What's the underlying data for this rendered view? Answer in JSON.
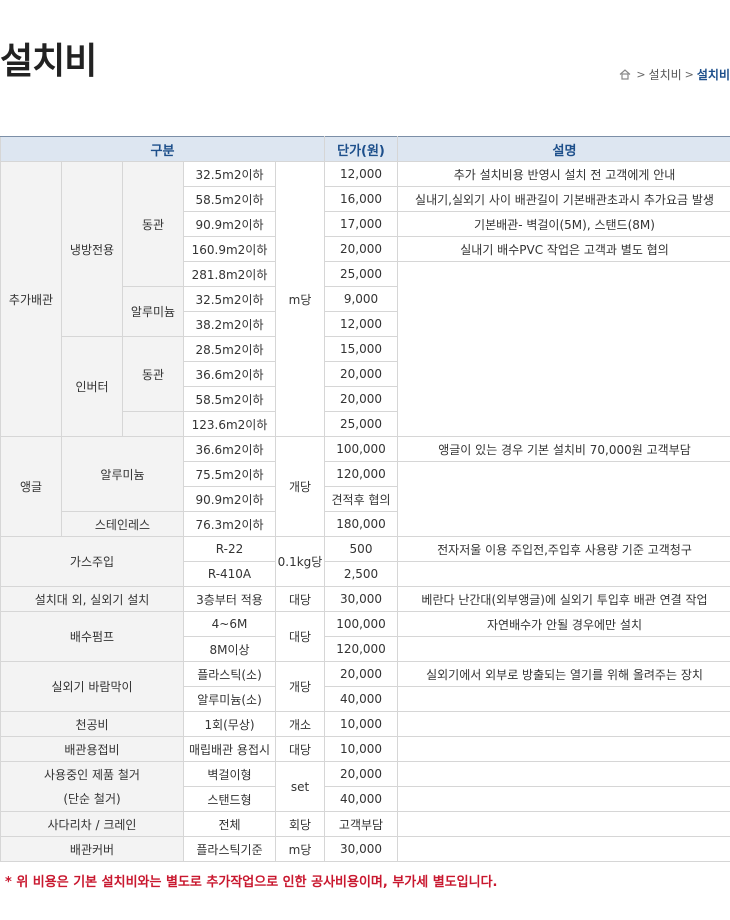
{
  "page": {
    "title": "설치비",
    "breadcrumb": [
      "설치비",
      "설치비"
    ],
    "footer_note": "* 위 비용은 기본 설치비와는 별도로 추가작업으로 인한 공사비용이며, 부가세 별도입니다."
  },
  "table": {
    "headers": {
      "category": "구분",
      "price": "단가(원)",
      "desc": "설명"
    },
    "colors": {
      "header_bg": "#dde6f1",
      "header_text": "#1d4f8b",
      "label_bg": "#f3f3f3",
      "note": "#c9182f"
    },
    "cells": {
      "c_extra": "추가배관",
      "c_cool": "냉방전용",
      "c_copper1": "동관",
      "c_alu1": "알루미늄",
      "c_inverter": "인버터",
      "c_copper2": "동관",
      "c_angle": "앵글",
      "c_alu2": "알루미늄",
      "c_stainless": "스테인레스",
      "u_m": "m당",
      "u_each": "개당",
      "c_gas": "가스주입",
      "u_kg": "0.1kg당",
      "c_stand": "설치대 외, 실외기 설치",
      "c_pump": "배수펌프",
      "u_each2": "대당",
      "c_wind": "실외기 바람막이",
      "u_each3": "개당",
      "c_ceiling": "천공비",
      "c_weld": "배관용접비",
      "c_remove1": "사용중인 제품 철거",
      "c_remove2": "(단순 철거)",
      "u_set": "set",
      "c_ladder": "사다리차 / 크레인",
      "c_cover": "배관커버"
    },
    "rows": [
      {
        "spec": "32.5m2이하",
        "price": "12,000",
        "desc": "추가 설치비용 반영시 설치 전 고객에게 안내"
      },
      {
        "spec": "58.5m2이하",
        "price": "16,000",
        "desc": "실내기,실외기 사이 배관길이  기본배관초과시 추가요금 발생"
      },
      {
        "spec": "90.9m2이하",
        "price": "17,000",
        "desc": "기본배관- 벽걸이(5M), 스탠드(8M)"
      },
      {
        "spec": "160.9m2이하",
        "price": "20,000",
        "desc": "실내기 배수PVC 작업은 고객과 별도 협의"
      },
      {
        "spec": "281.8m2이하",
        "price": "25,000",
        "desc": ""
      },
      {
        "spec": "32.5m2이하",
        "price": "9,000",
        "desc": ""
      },
      {
        "spec": "38.2m2이하",
        "price": "12,000",
        "desc": ""
      },
      {
        "spec": "28.5m2이하",
        "price": "15,000",
        "desc": ""
      },
      {
        "spec": "36.6m2이하",
        "price": "20,000",
        "desc": ""
      },
      {
        "spec": "58.5m2이하",
        "price": "20,000",
        "desc": ""
      },
      {
        "spec": "123.6m2이하",
        "price": "25,000",
        "desc": ""
      },
      {
        "spec": "36.6m2이하",
        "price": "100,000",
        "desc": "앵글이 있는 경우 기본 설치비 70,000원 고객부담"
      },
      {
        "spec": "75.5m2이하",
        "price": "120,000",
        "desc": ""
      },
      {
        "spec": "90.9m2이하",
        "price": "견적후 협의",
        "desc": ""
      },
      {
        "spec": "76.3m2이하",
        "price": "180,000",
        "desc": ""
      },
      {
        "spec": "R-22",
        "price": "500",
        "desc": "전자저울 이용 주입전,주입후 사용량 기준 고객청구"
      },
      {
        "spec": "R-410A",
        "price": "2,500",
        "desc": ""
      },
      {
        "spec": "3층부터 적용",
        "unit": "대당",
        "price": "30,000",
        "desc": "베란다 난간대(외부앵글)에 실외기 투입후 배관 연결 작업"
      },
      {
        "spec": "4~6M",
        "price": "100,000",
        "desc": "자연배수가 안될 경우에만 설치"
      },
      {
        "spec": "8M이상",
        "price": "120,000",
        "desc": ""
      },
      {
        "spec": "플라스틱(소)",
        "price": "20,000",
        "desc": "실외기에서 외부로 방출되는 열기를 위해 올려주는 장치"
      },
      {
        "spec": "알루미늄(소)",
        "price": "40,000",
        "desc": ""
      },
      {
        "spec": "1회(무상)",
        "unit": "개소",
        "price": "10,000",
        "desc": ""
      },
      {
        "spec": "매립배관 용접시",
        "unit": "대당",
        "price": "10,000",
        "desc": ""
      },
      {
        "spec": "벽걸이형",
        "price": "20,000",
        "desc": ""
      },
      {
        "spec": "스탠드형",
        "price": "40,000",
        "desc": ""
      },
      {
        "spec": "전체",
        "unit": "회당",
        "price": "고객부담",
        "desc": ""
      },
      {
        "spec": "플라스틱기준",
        "unit": "m당",
        "price": "30,000",
        "desc": ""
      }
    ]
  }
}
